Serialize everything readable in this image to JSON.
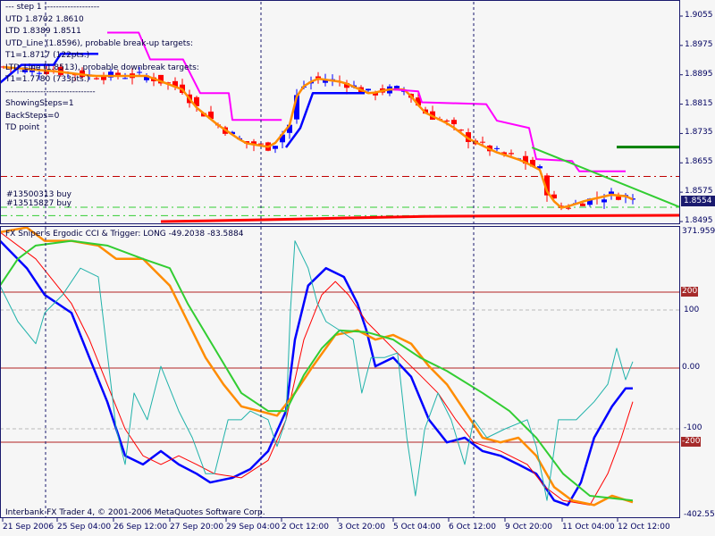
{
  "main_chart": {
    "info_lines": [
      "---   step 1   -------------------",
      "UTD  1.8702   1.8610",
      "LTD  1.8389   1.8511",
      "UTD_Line (1.8596), probable break-up targets:",
      "T1=1.8717 (122pts.)",
      "LTD_Line (1.8513), probable downbreak targets:",
      "T1=1.7780 (733pts.)",
      "-------------------------------",
      "ShowingSteps=1",
      "BackSteps=0",
      "TD point"
    ],
    "orders": [
      "#13500313 buy",
      "#13515827 buy"
    ],
    "price_axis": [
      "1.9055",
      "1.8975",
      "1.8895",
      "1.8815",
      "1.8735",
      "1.8655",
      "1.8575",
      "1.8495"
    ],
    "current_price": "1.8554",
    "colors": {
      "bull": "#0000ff",
      "bear": "#ff0000",
      "ma": "#ff8c00",
      "resistance": "#ff00ff",
      "support": "#0000ff",
      "trend": "#32cd32"
    }
  },
  "indicator": {
    "title": "FX Sniper's Ergodic CCI & Trigger: LONG -49.2038 -83.5884",
    "axis_top": "371.9599",
    "axis_bottom": "-402.557",
    "levels": [
      "200",
      "100",
      "0.00",
      "-100",
      "-200"
    ]
  },
  "copyright": "Interbank FX Trader 4, © 2001-2006 MetaQuotes Software Corp.",
  "time_axis": [
    "21 Sep 2006",
    "25 Sep 04:00",
    "26 Sep 12:00",
    "27 Sep 20:00",
    "29 Sep 04:00",
    "2 Oct 12:00",
    "3 Oct 20:00",
    "5 Oct 04:00",
    "6 Oct 12:00",
    "9 Oct 20:00",
    "11 Oct 04:00",
    "12 Oct 12:00"
  ],
  "chart_data": [
    {
      "type": "candlestick",
      "title": "Price",
      "ylim": [
        1.8495,
        1.9055
      ],
      "close_path": [
        [
          0,
          1.8916
        ],
        [
          7.5,
          1.8904
        ],
        [
          12.5,
          1.8892
        ],
        [
          20,
          1.8892
        ],
        [
          25,
          1.8855
        ],
        [
          26.9,
          1.8807
        ],
        [
          30,
          1.8758
        ],
        [
          33.75,
          1.8709
        ],
        [
          37.5,
          1.8697
        ],
        [
          40,
          1.8758
        ],
        [
          41.25,
          1.8855
        ],
        [
          43.75,
          1.8885
        ],
        [
          47.5,
          1.8875
        ],
        [
          51.25,
          1.8843
        ],
        [
          53.75,
          1.8855
        ],
        [
          56.25,
          1.8855
        ],
        [
          58.75,
          1.8794
        ],
        [
          62.5,
          1.8758
        ],
        [
          65,
          1.8721
        ],
        [
          68.75,
          1.8685
        ],
        [
          72.5,
          1.8661
        ],
        [
          75,
          1.8636
        ],
        [
          76.25,
          1.8563
        ],
        [
          78.1,
          1.8531
        ],
        [
          81.25,
          1.8551
        ],
        [
          85,
          1.8568
        ],
        [
          87.5,
          1.8563
        ],
        [
          88.1,
          1.8554
        ]
      ],
      "resistance": [
        [
          15,
          1.901
        ],
        [
          19.4,
          1.901
        ],
        [
          21,
          1.8937
        ],
        [
          25.6,
          1.8937
        ],
        [
          28,
          1.8845
        ],
        [
          32,
          1.8845
        ],
        [
          32.5,
          1.8772
        ],
        [
          39.4,
          1.8772
        ]
      ],
      "resistance2": [
        [
          55,
          1.8855
        ],
        [
          58.5,
          1.885
        ],
        [
          59,
          1.882
        ],
        [
          68,
          1.8815
        ],
        [
          69.5,
          1.877
        ],
        [
          74,
          1.875
        ],
        [
          75,
          1.8665
        ],
        [
          80,
          1.866
        ],
        [
          81,
          1.8632
        ],
        [
          87.5,
          1.8632
        ]
      ],
      "support": [
        [
          0,
          1.8873
        ],
        [
          3,
          1.8922
        ],
        [
          7.5,
          1.8922
        ],
        [
          8.5,
          1.8952
        ],
        [
          13.75,
          1.8952
        ]
      ],
      "support2": [
        [
          40,
          1.8697
        ],
        [
          42,
          1.875
        ],
        [
          43.75,
          1.8845
        ],
        [
          51,
          1.8845
        ]
      ],
      "trendline": [
        [
          74.4,
          1.8697
        ],
        [
          95,
          1.8535
        ]
      ],
      "red_base": [
        [
          22.5,
          1.8495
        ],
        [
          29.4,
          1.8497
        ],
        [
          36.9,
          1.85
        ],
        [
          44.4,
          1.8503
        ],
        [
          51.9,
          1.8506
        ],
        [
          59.4,
          1.8509
        ],
        [
          66.9,
          1.851
        ],
        [
          95,
          1.8512
        ]
      ],
      "levels": {
        "dash_dot_red": 1.8618,
        "order1": 1.8534,
        "order2": 1.8511,
        "dark_green": 1.8698
      }
    },
    {
      "type": "line",
      "title": "FX Sniper's Ergodic CCI & Trigger",
      "ylim": [
        -402.557,
        371.9599
      ],
      "series": [
        {
          "name": "Ergodic CCI",
          "color": "#0000ff",
          "points": [
            [
              0,
              219
            ],
            [
              3.75,
              172
            ],
            [
              6.25,
              126
            ],
            [
              10,
              95
            ],
            [
              12.5,
              18
            ],
            [
              15,
              -58
            ],
            [
              17.5,
              -151
            ],
            [
              20,
              -166
            ],
            [
              22.5,
              -143
            ],
            [
              25,
              -166
            ],
            [
              27.5,
              -182
            ],
            [
              29.4,
              -197
            ],
            [
              32.5,
              -189
            ],
            [
              35,
              -174
            ],
            [
              37.5,
              -143
            ],
            [
              40,
              -74
            ],
            [
              41.25,
              49
            ],
            [
              43.1,
              142
            ],
            [
              45.6,
              172
            ],
            [
              48.1,
              157
            ],
            [
              50,
              111
            ],
            [
              51.25,
              65
            ],
            [
              52.5,
              3
            ],
            [
              55,
              18
            ],
            [
              57.5,
              -15
            ],
            [
              60,
              -89
            ],
            [
              62.5,
              -128
            ],
            [
              65,
              -120
            ],
            [
              67.5,
              -143
            ],
            [
              70,
              -151
            ],
            [
              72.5,
              -166
            ],
            [
              75,
              -182
            ],
            [
              77.5,
              -228
            ],
            [
              79.4,
              -236
            ],
            [
              81.25,
              -197
            ],
            [
              83.1,
              -120
            ],
            [
              85.6,
              -66
            ],
            [
              87.5,
              -35
            ],
            [
              88.5,
              -35
            ]
          ]
        },
        {
          "name": "Trigger",
          "color": "#ff0000",
          "points": [
            [
              0,
              234
            ],
            [
              5,
              188
            ],
            [
              10,
              111
            ],
            [
              12.5,
              49
            ],
            [
              15,
              -28
            ],
            [
              17.5,
              -105
            ],
            [
              20,
              -151
            ],
            [
              22.5,
              -166
            ],
            [
              25,
              -151
            ],
            [
              27.5,
              -166
            ],
            [
              30,
              -182
            ],
            [
              33.75,
              -189
            ],
            [
              37.5,
              -159
            ],
            [
              40,
              -89
            ],
            [
              42.5,
              49
            ],
            [
              45,
              126
            ],
            [
              46.9,
              149
            ],
            [
              48.75,
              126
            ],
            [
              51.25,
              80
            ],
            [
              53.75,
              49
            ],
            [
              56.25,
              18
            ],
            [
              58.75,
              -12
            ],
            [
              61.25,
              -43
            ],
            [
              63.75,
              -89
            ],
            [
              66.25,
              -128
            ],
            [
              70,
              -143
            ],
            [
              73.75,
              -166
            ],
            [
              76.25,
              -205
            ],
            [
              78.75,
              -228
            ],
            [
              82.5,
              -236
            ],
            [
              85,
              -182
            ],
            [
              86.9,
              -120
            ],
            [
              88.5,
              -58
            ]
          ]
        },
        {
          "name": "Orange",
          "color": "#ff8c00",
          "points": [
            [
              0,
              234
            ],
            [
              3.75,
              242
            ],
            [
              6.25,
              219
            ],
            [
              10,
              219
            ],
            [
              13.75,
              211
            ],
            [
              16.25,
              188
            ],
            [
              20,
              188
            ],
            [
              23.75,
              142
            ],
            [
              26.25,
              80
            ],
            [
              28.75,
              18
            ],
            [
              31.25,
              -28
            ],
            [
              33.75,
              -66
            ],
            [
              36.25,
              -74
            ],
            [
              38.75,
              -82
            ],
            [
              41.25,
              -43
            ],
            [
              43.75,
              3
            ],
            [
              46.9,
              57
            ],
            [
              50,
              65
            ],
            [
              52.5,
              49
            ],
            [
              55,
              57
            ],
            [
              57.5,
              42
            ],
            [
              60,
              3
            ],
            [
              62.5,
              -28
            ],
            [
              65,
              -74
            ],
            [
              67.5,
              -120
            ],
            [
              70,
              -128
            ],
            [
              72.5,
              -120
            ],
            [
              75,
              -151
            ],
            [
              77.5,
              -205
            ],
            [
              80,
              -228
            ],
            [
              83.1,
              -236
            ],
            [
              85.6,
              -220
            ],
            [
              88.5,
              -231
            ]
          ]
        },
        {
          "name": "Green",
          "color": "#32cd32",
          "points": [
            [
              0,
              142
            ],
            [
              2.5,
              188
            ],
            [
              5,
              211
            ],
            [
              10,
              219
            ],
            [
              15,
              211
            ],
            [
              20,
              188
            ],
            [
              23.75,
              172
            ],
            [
              26.25,
              111
            ],
            [
              30,
              34
            ],
            [
              33.75,
              -43
            ],
            [
              37.5,
              -74
            ],
            [
              40,
              -74
            ],
            [
              42.5,
              -12
            ],
            [
              45,
              34
            ],
            [
              47.5,
              65
            ],
            [
              51.25,
              62
            ],
            [
              55,
              49
            ],
            [
              58.75,
              18
            ],
            [
              62.5,
              -5
            ],
            [
              67.5,
              -43
            ],
            [
              71.25,
              -74
            ],
            [
              75,
              -120
            ],
            [
              78.75,
              -182
            ],
            [
              82.5,
              -220
            ],
            [
              86.25,
              -225
            ],
            [
              88.5,
              -228
            ]
          ]
        },
        {
          "name": "Teal",
          "color": "#20b2aa",
          "points": [
            [
              0,
              142
            ],
            [
              2.5,
              80
            ],
            [
              5,
              42
            ],
            [
              6.25,
              95
            ],
            [
              8.75,
              126
            ],
            [
              11.25,
              172
            ],
            [
              13.75,
              157
            ],
            [
              16.25,
              -105
            ],
            [
              17.5,
              -166
            ],
            [
              18.75,
              -43
            ],
            [
              20.6,
              -89
            ],
            [
              22.5,
              3
            ],
            [
              25,
              -74
            ],
            [
              26.9,
              -120
            ],
            [
              28.75,
              -182
            ],
            [
              30,
              -182
            ],
            [
              31.9,
              -89
            ],
            [
              33.75,
              -89
            ],
            [
              35,
              -74
            ],
            [
              37.5,
              -89
            ],
            [
              38.75,
              -135
            ],
            [
              40,
              -89
            ],
            [
              40.6,
              95
            ],
            [
              41.25,
              219
            ],
            [
              43.1,
              172
            ],
            [
              44.4,
              111
            ],
            [
              45.6,
              80
            ],
            [
              47.5,
              65
            ],
            [
              49.4,
              49
            ],
            [
              50.6,
              -43
            ],
            [
              51.9,
              18
            ],
            [
              53.75,
              18
            ],
            [
              55.6,
              26
            ],
            [
              56.9,
              -120
            ],
            [
              58.1,
              -220
            ],
            [
              59.4,
              -105
            ],
            [
              61.25,
              -43
            ],
            [
              63.1,
              -89
            ],
            [
              65,
              -166
            ],
            [
              66.25,
              -89
            ],
            [
              68.1,
              -120
            ],
            [
              70.6,
              -105
            ],
            [
              73.75,
              -89
            ],
            [
              75,
              -135
            ],
            [
              76.5,
              -228
            ],
            [
              78.1,
              -89
            ],
            [
              80.6,
              -89
            ],
            [
              83.1,
              -58
            ],
            [
              85,
              -28
            ],
            [
              86.25,
              34
            ],
            [
              87.5,
              -20
            ],
            [
              88.5,
              11
            ]
          ]
        }
      ]
    }
  ]
}
